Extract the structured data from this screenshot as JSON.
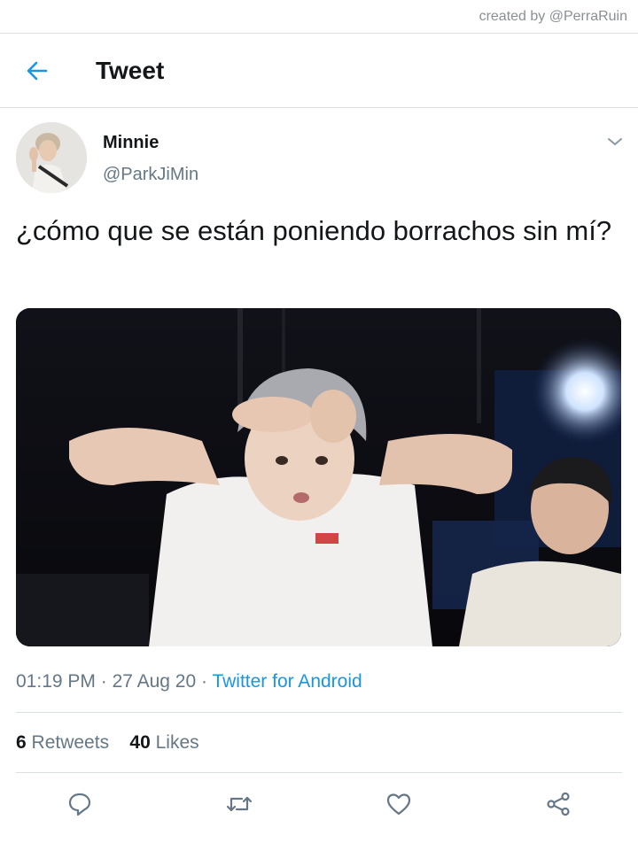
{
  "watermark": "created by @PerraRuin",
  "header": {
    "title": "Tweet",
    "back_icon": "arrow-left-icon"
  },
  "tweet": {
    "display_name": "Minnie",
    "handle": "@ParkJiMin",
    "text": "¿cómo que se están poniendo borrachos sin mí?",
    "time": "01:19 PM",
    "date": "27 Aug 20",
    "source": "Twitter for Android",
    "retweets_count": "6",
    "retweets_label": "Retweets",
    "likes_count": "40",
    "likes_label": "Likes"
  },
  "actions": [
    {
      "name": "reply",
      "icon": "reply-icon"
    },
    {
      "name": "retweet",
      "icon": "retweet-icon"
    },
    {
      "name": "like",
      "icon": "heart-icon"
    },
    {
      "name": "share",
      "icon": "share-icon"
    }
  ],
  "colors": {
    "accent": "#1b95e0",
    "text_primary": "#14171a",
    "text_secondary": "#657786",
    "divider": "#dcdfe2"
  }
}
